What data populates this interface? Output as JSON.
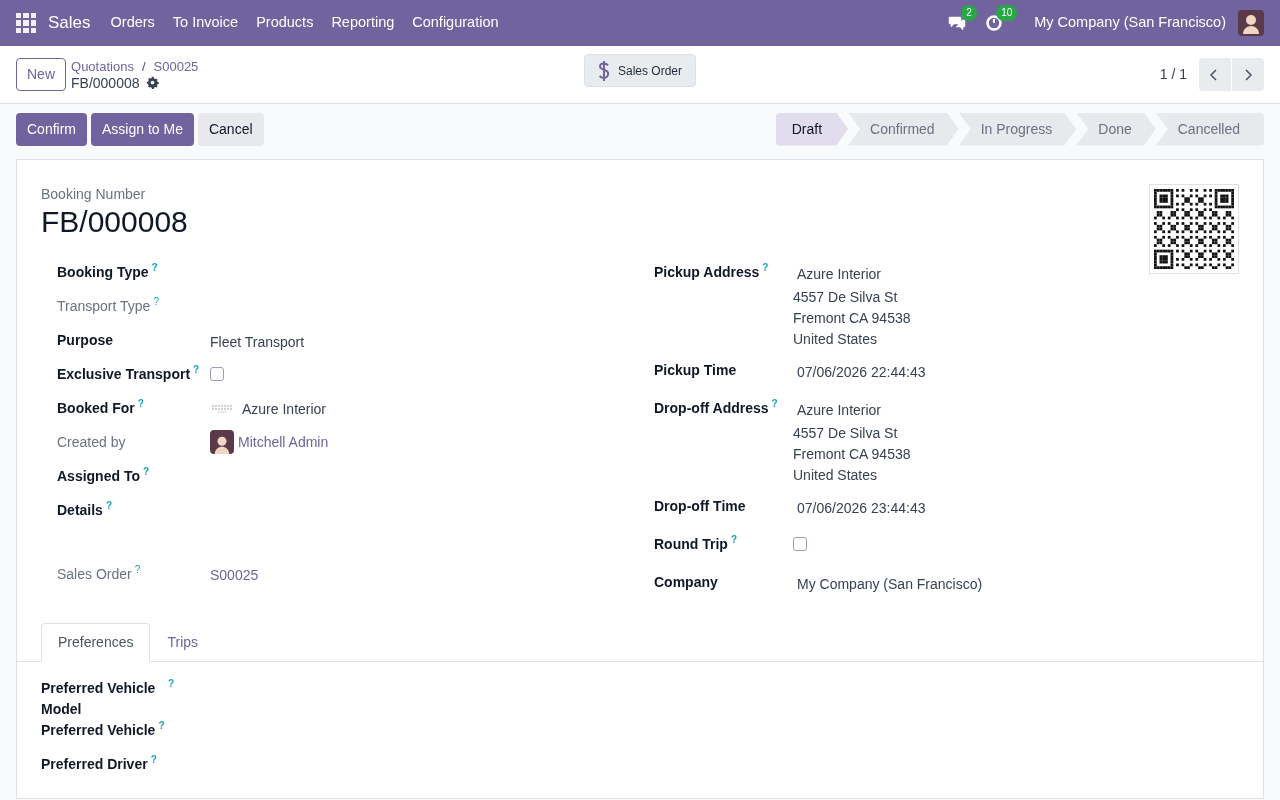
{
  "navbar": {
    "app": "Sales",
    "menu": [
      "Orders",
      "To Invoice",
      "Products",
      "Reporting",
      "Configuration"
    ],
    "messages_count": "2",
    "activities_count": "10",
    "company": "My Company (San Francisco)"
  },
  "control_panel": {
    "new_button": "New",
    "breadcrumbs": [
      "Quotations",
      "S00025"
    ],
    "breadcrumb_separator": "/",
    "record": "FB/000008",
    "smart_button": "Sales Order",
    "pager": "1 / 1"
  },
  "actions": [
    {
      "label": "Confirm",
      "kind": "primary"
    },
    {
      "label": "Assign to Me",
      "kind": "primary"
    },
    {
      "label": "Cancel",
      "kind": "secondary"
    }
  ],
  "statusbar": [
    {
      "label": "Draft",
      "selected": true
    },
    {
      "label": "Confirmed",
      "selected": false
    },
    {
      "label": "In Progress",
      "selected": false
    },
    {
      "label": "Done",
      "selected": false
    },
    {
      "label": "Cancelled",
      "selected": false
    }
  ],
  "help_mark": "?",
  "form": {
    "title_label": "Booking Number",
    "title": "FB/000008",
    "left_fields": [
      {
        "label": "Booking Type",
        "help": true,
        "readonly": false,
        "kind": "empty"
      },
      {
        "label": "Transport Type",
        "help": true,
        "readonly": true,
        "kind": "empty"
      },
      {
        "label": "Purpose",
        "help": false,
        "readonly": false,
        "kind": "text",
        "value": "Fleet Transport"
      },
      {
        "label": "Exclusive Transport",
        "help": true,
        "readonly": false,
        "kind": "checkbox",
        "checked": false
      },
      {
        "label": "Booked For",
        "help": true,
        "readonly": false,
        "kind": "partner",
        "value": "Azure Interior"
      },
      {
        "label": "Created by",
        "help": false,
        "readonly": true,
        "kind": "user",
        "value": "Mitchell Admin"
      },
      {
        "label": "Assigned To",
        "help": true,
        "readonly": false,
        "kind": "empty"
      },
      {
        "label": "Details",
        "help": true,
        "readonly": false,
        "kind": "html"
      },
      {
        "label": "Sales Order",
        "help": true,
        "readonly": true,
        "kind": "link",
        "value": "S00025"
      }
    ],
    "right_fields": [
      {
        "label": "Pickup Address",
        "help": true,
        "kind": "address",
        "value": "Azure Interior",
        "lines": [
          "4557 De Silva St",
          "Fremont CA 94538",
          "United States"
        ]
      },
      {
        "label": "Pickup Time",
        "help": false,
        "kind": "text",
        "value": "07/06/2026 22:44:43"
      },
      {
        "label": "Drop-off Address",
        "help": true,
        "kind": "address",
        "value": "Azure Interior",
        "lines": [
          "4557 De Silva St",
          "Fremont CA 94538",
          "United States"
        ]
      },
      {
        "label": "Drop-off Time",
        "help": false,
        "kind": "text",
        "value": "07/06/2026 23:44:43"
      },
      {
        "label": "Round Trip",
        "help": true,
        "kind": "checkbox",
        "checked": false
      },
      {
        "label": "Company",
        "help": false,
        "kind": "text",
        "value": "My Company (San Francisco)"
      }
    ]
  },
  "tabs": [
    {
      "label": "Preferences",
      "selected": true
    },
    {
      "label": "Trips",
      "selected": false
    }
  ],
  "preference_fields": [
    {
      "label": "Preferred Vehicle Model",
      "help": true
    },
    {
      "label": "Preferred Vehicle",
      "help": true
    },
    {
      "label": "Preferred Driver",
      "help": true
    }
  ]
}
